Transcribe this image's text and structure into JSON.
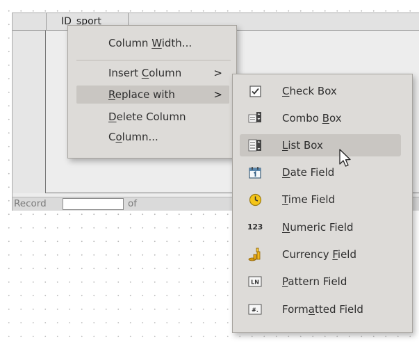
{
  "grid": {
    "column_header": "ID_sport",
    "nav": {
      "record_label": "Record",
      "of_label": "of"
    }
  },
  "context_menu": {
    "items": [
      {
        "pre": "Column ",
        "key": "W",
        "post": "idth..."
      },
      {
        "pre": "Insert ",
        "key": "C",
        "post": "olumn",
        "arrow": ">"
      },
      {
        "pre": "",
        "key": "R",
        "post": "eplace with",
        "arrow": ">"
      },
      {
        "pre": "",
        "key": "D",
        "post": "elete Column"
      },
      {
        "pre": "C",
        "key": "o",
        "post": "lumn..."
      }
    ]
  },
  "submenu": {
    "items": [
      {
        "icon": "checkbox-icon",
        "pre": "",
        "key": "C",
        "post": "heck Box"
      },
      {
        "icon": "combo-box-icon",
        "pre": "Combo ",
        "key": "B",
        "post": "ox"
      },
      {
        "icon": "list-box-icon",
        "pre": "",
        "key": "L",
        "post": "ist Box"
      },
      {
        "icon": "calendar-icon",
        "pre": "",
        "key": "D",
        "post": "ate Field"
      },
      {
        "icon": "clock-icon",
        "pre": "",
        "key": "T",
        "post": "ime Field"
      },
      {
        "icon": "numeric-icon",
        "icon_text": "123",
        "pre": "",
        "key": "N",
        "post": "umeric Field"
      },
      {
        "icon": "currency-icon",
        "pre": "Currency ",
        "key": "F",
        "post": "ield"
      },
      {
        "icon": "pattern-icon",
        "icon_text": "LN",
        "pre": "",
        "key": "P",
        "post": "attern Field"
      },
      {
        "icon": "formatted-icon",
        "icon_text": "#.",
        "pre": "Form",
        "key": "a",
        "post": "tted Field"
      }
    ]
  },
  "colors": {
    "menu_bg": "#dddbd8",
    "highlight": "#c9c6c2",
    "grid_bg": "#ededed"
  }
}
